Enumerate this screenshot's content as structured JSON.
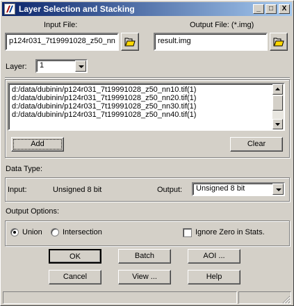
{
  "window": {
    "title": "Layer Selection and Stacking",
    "minimize": "_",
    "maximize": "□",
    "close": "X"
  },
  "input_file": {
    "label": "Input File:",
    "value": "p124r031_7t19991028_z50_nn"
  },
  "output_file": {
    "label": "Output File: (*.img)",
    "value": "result.img"
  },
  "layer": {
    "label": "Layer:",
    "value": "1"
  },
  "layer_list": {
    "items": [
      "d:/data/dubinin/p124r031_7t19991028_z50_nn10.tif(1)",
      "d:/data/dubinin/p124r031_7t19991028_z50_nn20.tif(1)",
      "d:/data/dubinin/p124r031_7t19991028_z50_nn30.tif(1)",
      "d:/data/dubinin/p124r031_7t19991028_z50_nn40.tif(1)"
    ]
  },
  "list_buttons": {
    "add": "Add",
    "clear": "Clear"
  },
  "data_type": {
    "heading": "Data Type:",
    "input_label": "Input:",
    "input_value": "Unsigned 8 bit",
    "output_label": "Output:",
    "output_value": "Unsigned 8 bit"
  },
  "output_options": {
    "heading": "Output Options:",
    "union": "Union",
    "intersection": "Intersection",
    "ignore_zero": "Ignore Zero in Stats.",
    "selected": "union",
    "ignore_zero_checked": false
  },
  "buttons": {
    "ok": "OK",
    "batch": "Batch",
    "aoi": "AOI ...",
    "cancel": "Cancel",
    "view": "View ...",
    "help": "Help"
  }
}
